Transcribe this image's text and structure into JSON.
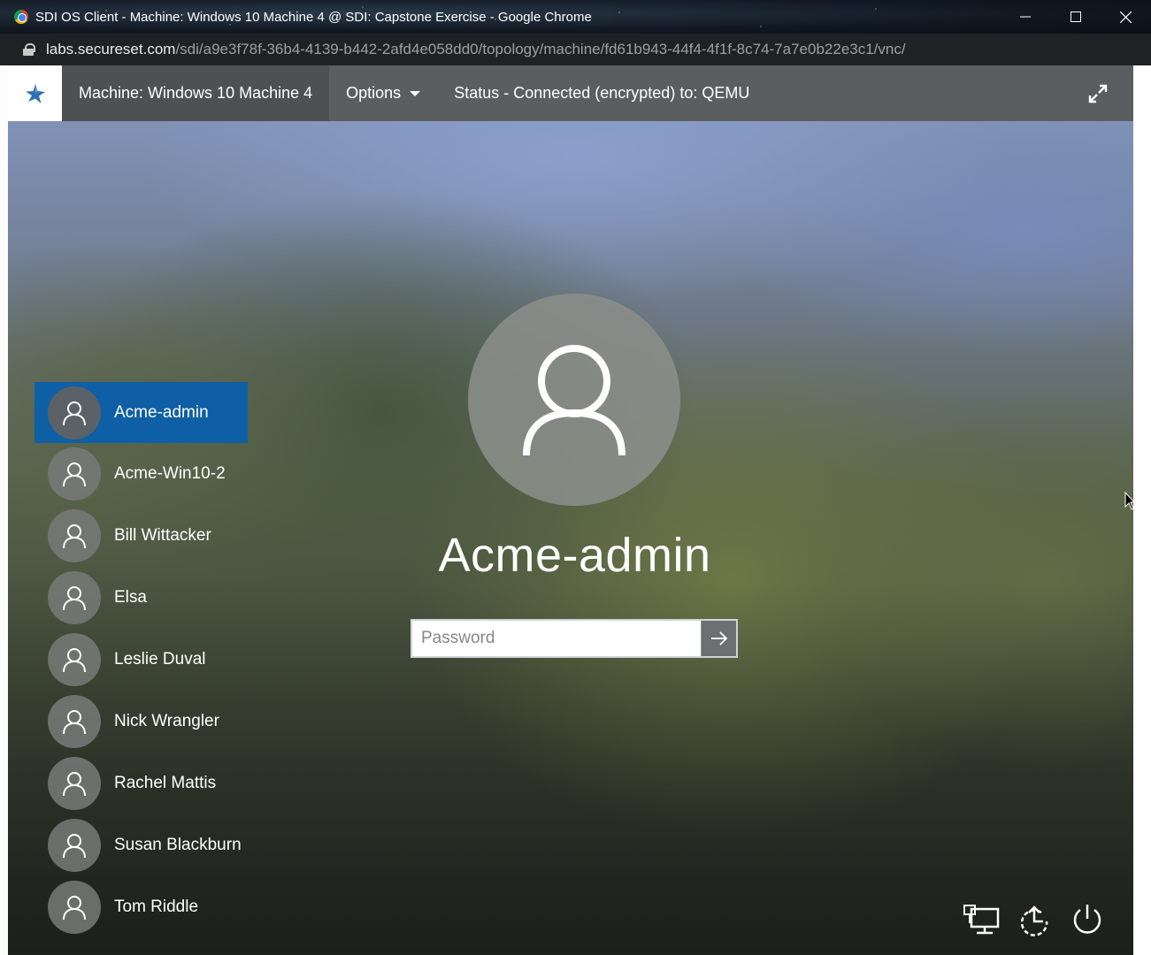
{
  "browser": {
    "window_title": "SDI OS Client - Machine: Windows 10 Machine 4 @ SDI: Capstone Exercise - Google Chrome",
    "url_host": "labs.secureset.com",
    "url_path": "/sdi/a9e3f78f-36b4-4139-b442-2afd4e058dd0/topology/machine/fd61b943-44f4-4f1f-8c74-7a7e0b22e3c1/vnc/"
  },
  "nav": {
    "machine_label": "Machine: Windows 10 Machine 4",
    "options_label": "Options",
    "status_label": "Status - Connected (encrypted) to: QEMU"
  },
  "login": {
    "users": [
      {
        "name": "Acme-admin",
        "selected": true
      },
      {
        "name": "Acme-Win10-2",
        "selected": false
      },
      {
        "name": "Bill Wittacker",
        "selected": false
      },
      {
        "name": "Elsa",
        "selected": false
      },
      {
        "name": "Leslie Duval",
        "selected": false
      },
      {
        "name": "Nick Wrangler",
        "selected": false
      },
      {
        "name": "Rachel Mattis",
        "selected": false
      },
      {
        "name": "Susan Blackburn",
        "selected": false
      },
      {
        "name": "Tom Riddle",
        "selected": false
      }
    ],
    "selected_user": "Acme-admin",
    "password_placeholder": "Password",
    "password_value": ""
  },
  "colors": {
    "selected_user_bg": "#0e5fa6",
    "nav_bg": "#5b5e61"
  },
  "icons": {
    "network": "network-icon",
    "ease_of_access": "ease-of-access-icon",
    "power": "power-icon",
    "expand": "expand-icon"
  }
}
